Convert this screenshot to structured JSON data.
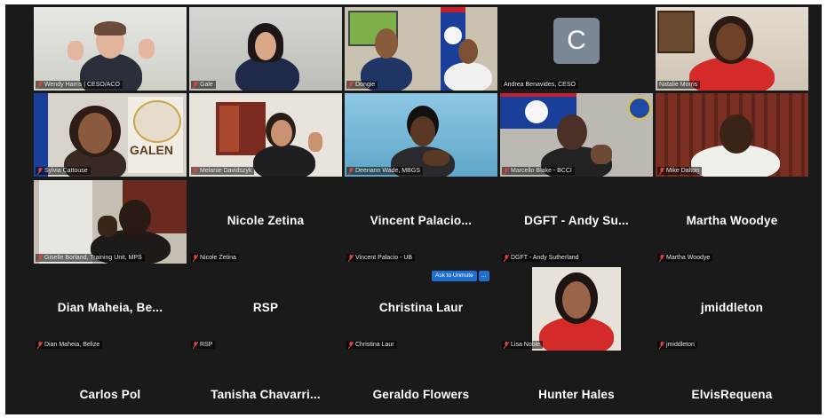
{
  "participants": {
    "hannah_harris": {
      "tag": "Wendy Harris | CESO/ACO"
    },
    "gale": {
      "tag": "Gale"
    },
    "dongie": {
      "tag": "Dongie"
    },
    "andrea": {
      "tag": "Andrea Benavides, CESO",
      "initial": "C"
    },
    "natalie": {
      "tag": "Natalie Morris"
    },
    "sylvia": {
      "tag": "Sylvia Cattouse"
    },
    "melanie": {
      "tag": "Melanie Davidszyk"
    },
    "deenamm": {
      "tag": "Deenann Wade, MBGS"
    },
    "marcello": {
      "tag": "Marcello Blake - BCCI"
    },
    "mike": {
      "tag": "Mike Dalton"
    },
    "giselle": {
      "tag": "Giselle Borland, Training Unit, MPS"
    },
    "nicole": {
      "name": "Nicole Zetina",
      "tag": "Nicole Zetina"
    },
    "vincent": {
      "name": "Vincent  Palacio...",
      "tag": "Vincent Palacio - UB"
    },
    "dgft": {
      "name": "DGFT - Andy Su...",
      "tag": "DGFT - Andy Sutherland"
    },
    "martha": {
      "name": "Martha Woodye",
      "tag": "Martha Woodye"
    },
    "dian": {
      "name": "Dian Maheia, Be...",
      "tag": "Dian Maheia, Belize"
    },
    "rsp": {
      "name": "RSP",
      "tag": "RSP"
    },
    "christina": {
      "name": "Christina Laur",
      "tag": "Christina Laur"
    },
    "lisa": {
      "tag": "Lisa Noble"
    },
    "jmiddleton": {
      "name": "jmiddleton",
      "tag": "jmiddleton"
    },
    "carlos": {
      "name": "Carlos Pol"
    },
    "tanisha": {
      "name": "Tanisha  Chavarri..."
    },
    "geraldo": {
      "name": "Geraldo Flowers"
    },
    "hunter": {
      "name": "Hunter Hales"
    },
    "elvis": {
      "name": "ElvisRequena"
    }
  },
  "ask_to_unmute": {
    "label": "Ask to Unmute",
    "more": "..."
  },
  "colors": {
    "background": "#1a1a1a",
    "active_speaker": "#9bd13d",
    "button": "#1f6fd1",
    "mic_muted": "#e0453a"
  }
}
